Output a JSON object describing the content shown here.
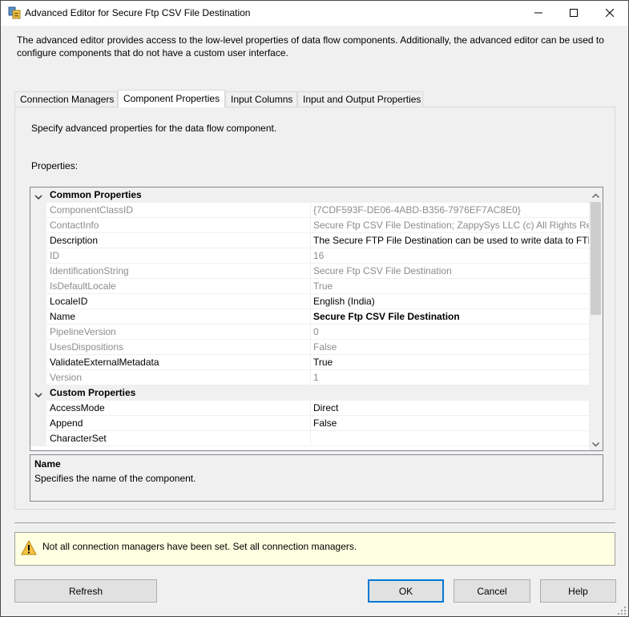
{
  "window": {
    "title": "Advanced Editor for Secure Ftp CSV File Destination"
  },
  "description": "The advanced editor provides access to the low-level properties of data flow components. Additionally, the advanced editor can be used to configure components that do not have a custom user interface.",
  "tabs": [
    {
      "label": "Connection Managers",
      "active": false
    },
    {
      "label": "Component Properties",
      "active": true
    },
    {
      "label": "Input Columns",
      "active": false
    },
    {
      "label": "Input and Output Properties",
      "active": false
    }
  ],
  "panel": {
    "intro": "Specify advanced properties for the data flow component.",
    "properties_label": "Properties:"
  },
  "grid": {
    "categories": {
      "common": "Common Properties",
      "custom": "Custom Properties"
    },
    "common_rows": [
      {
        "name": "ComponentClassID",
        "value": "{7CDF593F-DE06-4ABD-B356-7976EF7AC8E0}",
        "readonly": true
      },
      {
        "name": "ContactInfo",
        "value": "Secure Ftp CSV File Destination; ZappySys LLC (c) All Rights Reserved",
        "readonly": true
      },
      {
        "name": "Description",
        "value": "The Secure FTP File Destination can be used to write data to FTP Server",
        "readonly": false
      },
      {
        "name": "ID",
        "value": "16",
        "readonly": true
      },
      {
        "name": "IdentificationString",
        "value": "Secure Ftp CSV File Destination",
        "readonly": true
      },
      {
        "name": "IsDefaultLocale",
        "value": "True",
        "readonly": true
      },
      {
        "name": "LocaleID",
        "value": "English (India)",
        "readonly": false
      },
      {
        "name": "Name",
        "value": "Secure Ftp CSV File Destination",
        "readonly": false,
        "bold": true
      },
      {
        "name": "PipelineVersion",
        "value": "0",
        "readonly": true
      },
      {
        "name": "UsesDispositions",
        "value": "False",
        "readonly": true
      },
      {
        "name": "ValidateExternalMetadata",
        "value": "True",
        "readonly": false
      },
      {
        "name": "Version",
        "value": "1",
        "readonly": true
      }
    ],
    "custom_rows": [
      {
        "name": "AccessMode",
        "value": "Direct",
        "readonly": false
      },
      {
        "name": "Append",
        "value": "False",
        "readonly": false
      },
      {
        "name": "CharacterSet",
        "value": "",
        "readonly": false
      }
    ]
  },
  "help": {
    "title": "Name",
    "text": "Specifies the name of the component."
  },
  "warning": {
    "text": "Not all connection managers have been set. Set all connection managers."
  },
  "buttons": {
    "refresh": "Refresh",
    "ok": "OK",
    "cancel": "Cancel",
    "help": "Help"
  },
  "colors": {
    "accent": "#0078d7",
    "warning_bg": "#ffffe1",
    "readonly_text": "#8c8c8c"
  }
}
